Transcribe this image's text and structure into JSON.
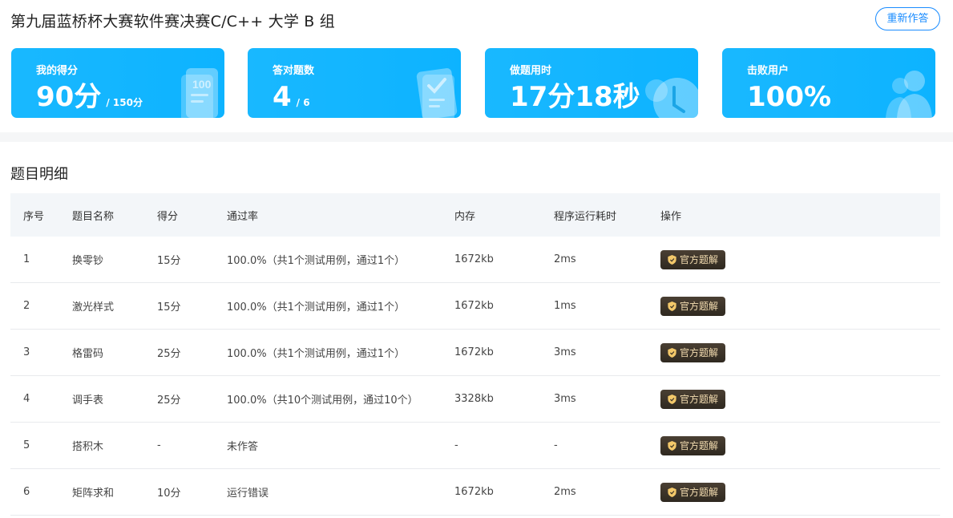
{
  "header": {
    "title": "第九届蓝桥杯大赛软件赛决赛C/C++ 大学 B 组",
    "redo_label": "重新作答"
  },
  "cards": [
    {
      "label": "我的得分",
      "value": "90分",
      "sub": "/ 150分",
      "icon": "score-sheet-icon"
    },
    {
      "label": "答对题数",
      "value": "4",
      "sub": "/ 6",
      "icon": "checklist-icon"
    },
    {
      "label": "做题用时",
      "value": "17分18秒",
      "sub": "",
      "icon": "clock-icon"
    },
    {
      "label": "击败用户",
      "value": "100%",
      "sub": "",
      "icon": "users-icon"
    }
  ],
  "section": {
    "title": "题目明细"
  },
  "table": {
    "headers": [
      "序号",
      "题目名称",
      "得分",
      "通过率",
      "内存",
      "程序运行耗时",
      "操作"
    ],
    "rows": [
      [
        "1",
        "换零钞",
        "15分",
        "100.0%（共1个测试用例，通过1个）",
        "1672kb",
        "2ms",
        "官方题解"
      ],
      [
        "2",
        "激光样式",
        "15分",
        "100.0%（共1个测试用例，通过1个）",
        "1672kb",
        "1ms",
        "官方题解"
      ],
      [
        "3",
        "格雷码",
        "25分",
        "100.0%（共1个测试用例，通过1个）",
        "1672kb",
        "3ms",
        "官方题解"
      ],
      [
        "4",
        "调手表",
        "25分",
        "100.0%（共10个测试用例，通过10个）",
        "3328kb",
        "3ms",
        "官方题解"
      ],
      [
        "5",
        "搭积木",
        "-",
        "未作答",
        "-",
        "-",
        "官方题解"
      ],
      [
        "6",
        "矩阵求和",
        "10分",
        "运行错误",
        "1672kb",
        "2ms",
        "官方题解"
      ]
    ]
  },
  "colors": {
    "card_blue": "#0db3ff",
    "accent": "#1a8cff",
    "solution_btn": "#3a3228",
    "solution_text": "#f3dcb0"
  }
}
